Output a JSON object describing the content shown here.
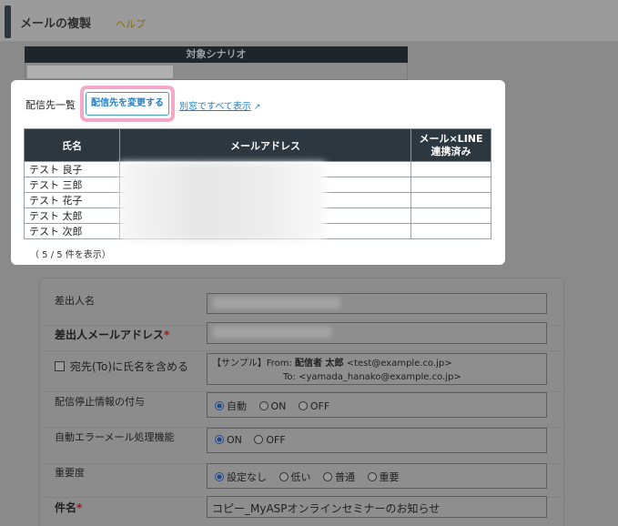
{
  "header": {
    "title": "メールの複製",
    "help": "ヘルプ"
  },
  "scenario": {
    "label": "対象シナリオ"
  },
  "popup": {
    "list_label": "配信先一覧",
    "change_button": "配信先を変更する",
    "show_all_link": "別窓ですべて表示",
    "table": {
      "headers": [
        "氏名",
        "メールアドレス",
        "メール×LINE",
        "連携済み"
      ],
      "rows": [
        {
          "name": "テスト 良子"
        },
        {
          "name": "テスト 三郎"
        },
        {
          "name": "テスト 花子"
        },
        {
          "name": "テスト 太郎"
        },
        {
          "name": "テスト 次郎"
        }
      ]
    },
    "count_text": "（ 5 / 5 件を表示）"
  },
  "form": {
    "sender_name_label": "差出人名",
    "sender_email_label": "差出人メールアドレス",
    "required_mark": "*",
    "to_name_label": "宛先(To)に氏名を含める",
    "sample_prefix": "【サンプル】From:",
    "sample_from_name": "配信者 太郎",
    "sample_from_addr": "<test@example.co.jp>",
    "sample_to_label": "To:",
    "sample_to_addr": "<yamada_hanako@example.co.jp>",
    "unsubscribe_label": "配信停止情報の付与",
    "unsubscribe_options": [
      "自動",
      "ON",
      "OFF"
    ],
    "auto_error_label": "自動エラーメール処理機能",
    "auto_error_options": [
      "ON",
      "OFF"
    ],
    "priority_label": "重要度",
    "priority_options": [
      "設定なし",
      "低い",
      "普通",
      "重要"
    ],
    "subject_label": "件名",
    "subject_value": "コピー_MyASPオンラインセミナーのお知らせ"
  }
}
